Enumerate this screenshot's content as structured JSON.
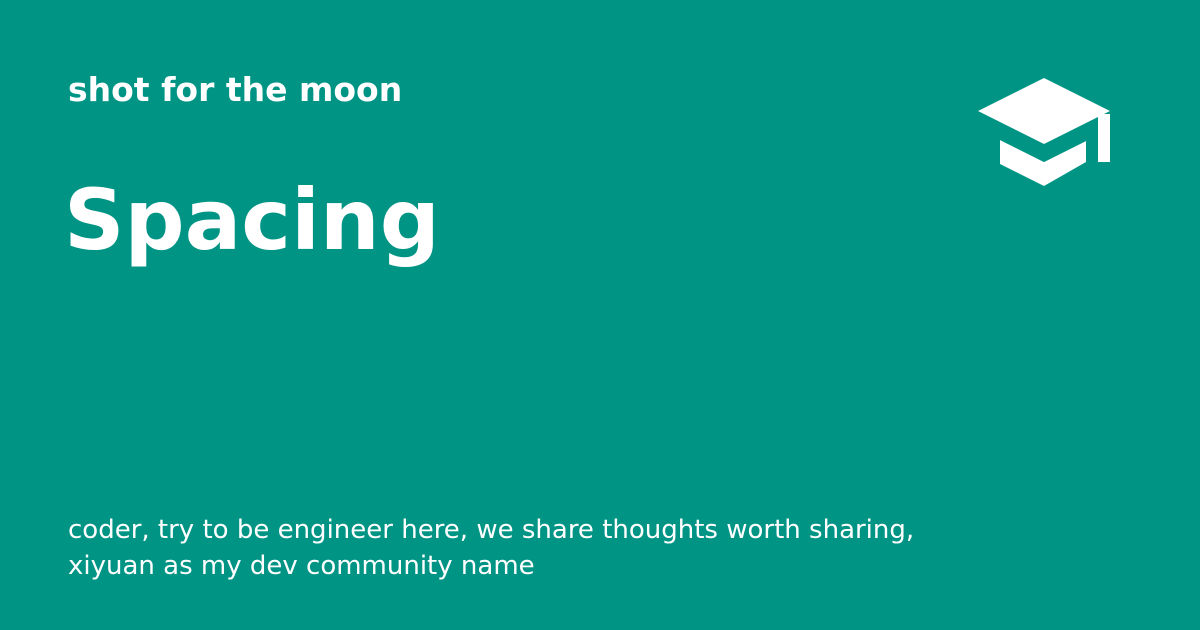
{
  "site": {
    "name": "shot for the moon",
    "logo_icon": "graduation-cap-icon"
  },
  "page": {
    "title": "Spacing"
  },
  "description": {
    "lines": [
      "coder, try to be engineer here, we share thoughts worth sharing,",
      "xiyuan as my dev community name"
    ]
  },
  "colors": {
    "background": "#009485",
    "foreground": "#ffffff"
  }
}
